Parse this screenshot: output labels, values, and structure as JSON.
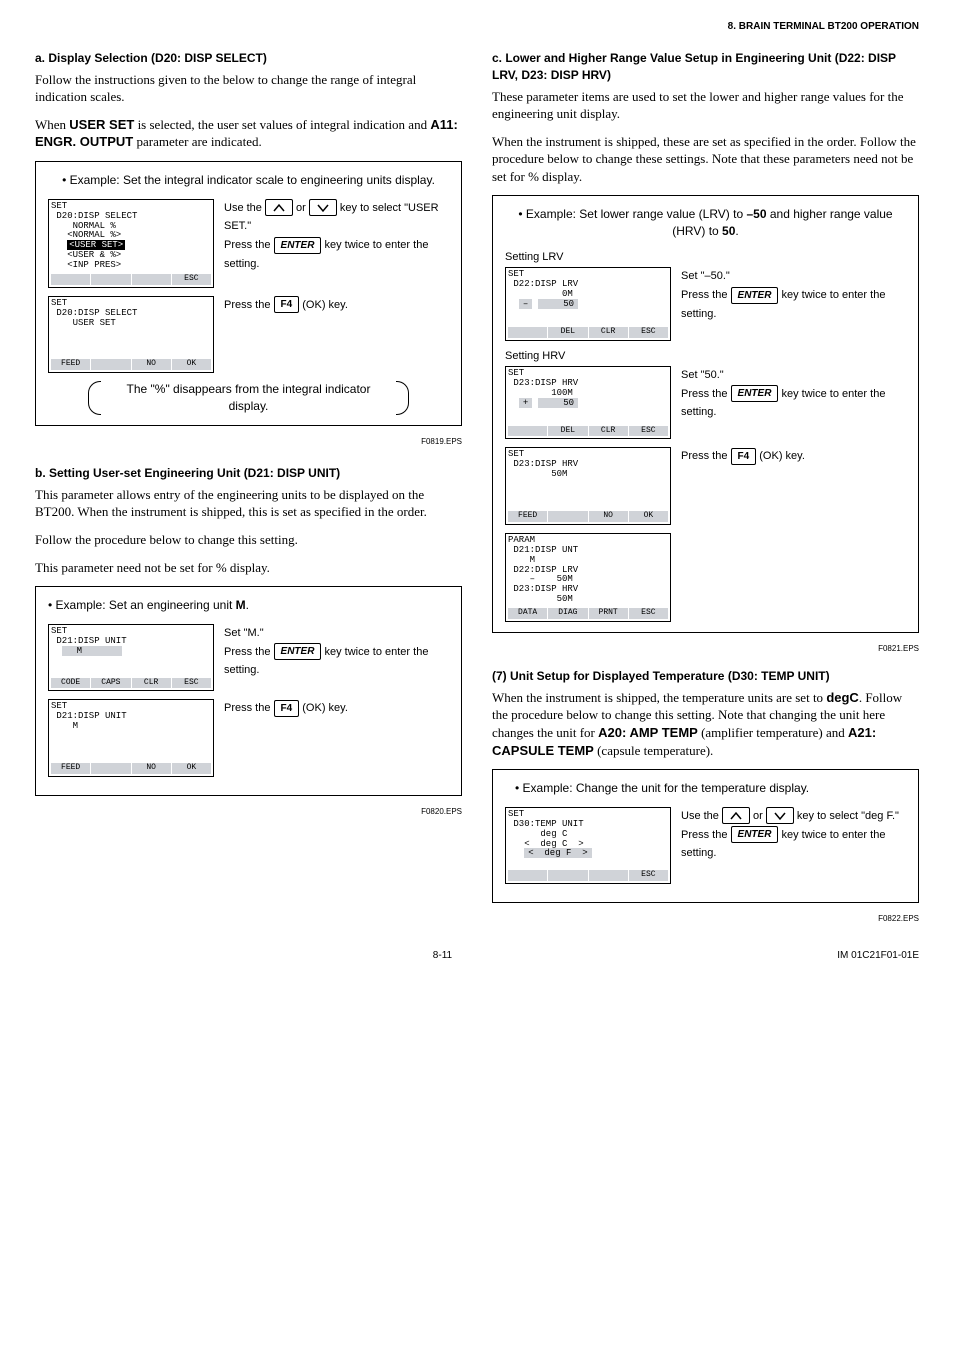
{
  "header": "8. BRAIN TERMINAL BT200 OPERATION",
  "left": {
    "a_title": "a. Display Selection (D20: DISP SELECT)",
    "a_p1": "Follow the instructions given to the below to change the range of integral indication scales.",
    "a_p2a": "When ",
    "a_p2b": "USER SET",
    "a_p2c": " is selected, the user set values of integral indication and ",
    "a_p2d": "A11: ENGR. OUTPUT",
    "a_p2e": " parameter are indicated.",
    "ex1_title": "• Example: Set the integral indicator scale to engineering units display.",
    "lcd1": {
      "l1": "SET",
      "l2": " D20:DISP SELECT",
      "l3": "    NORMAL %",
      "l4": "   <NORMAL %>",
      "l5hi": "<USER SET>",
      "l6": "   <USER & %>",
      "l7": "   <INP PRES>"
    },
    "d1a": "Use the ",
    "d1b": " or ",
    "d1c": " key to select \"USER SET.\"",
    "d1d": "Press the ",
    "d1e": " key twice to enter the setting.",
    "lcd2": {
      "l1": "SET",
      "l2": " D20:DISP SELECT",
      "l3": "    USER SET"
    },
    "d2a": "Press the ",
    "d2b": " (OK) key.",
    "bracket1": "The \"%\" disappears from the integral indicator display.",
    "fig1": "F0819.EPS",
    "sk": {
      "feed": "FEED",
      "no": "NO",
      "ok": "OK",
      "esc": "ESC",
      "code": "CODE",
      "caps": "CAPS",
      "clr": "CLR",
      "del": "DEL",
      "data": "DATA",
      "diag": "DIAG",
      "prnt": "PRNT"
    },
    "keys": {
      "enter": "ENTER",
      "f4": "F4"
    },
    "b_title": "b. Setting User-set Engineering Unit (D21: DISP UNIT)",
    "b_p1": "This parameter allows entry of the engineering units to be displayed on the BT200. When the instrument is shipped, this is set as specified in the order.",
    "b_p2": "Follow the procedure below to change this setting.",
    "b_p3": "This parameter need not be set for % display.",
    "ex2_title": "• Example: Set an engineering unit ",
    "ex2_title_b": "M",
    "lcd3": {
      "l1": "SET",
      "l2": " D21:DISP UNIT",
      "l3": "  M"
    },
    "d3a": "Set \"M.\"",
    "lcd4": {
      "l1": "SET",
      "l2": " D21:DISP UNIT",
      "l3": "    M"
    },
    "fig2": "F0820.EPS"
  },
  "right": {
    "c_title": "c. Lower and Higher Range Value Setup in Engineering Unit (D22: DISP LRV, D23: DISP HRV)",
    "c_p1": "These parameter items are used to set the lower and higher range values for the engineering unit display.",
    "c_p2": "When the instrument is shipped, these are set as specified in the order. Follow the procedure below to change these settings. Note that these parameters need not be set for % display.",
    "ex3_t1": "• Example: Set lower range value (LRV) to ",
    "ex3_t2": "–50",
    "ex3_t3": " and higher range value (HRV) to ",
    "ex3_t4": "50",
    "sub_lrv": "Setting LRV",
    "lcd5": {
      "l1": "SET",
      "l2": " D22:DISP LRV",
      "l3": "          0M",
      "l4a": "–",
      "l4b": "    50"
    },
    "d5a": "Set \"–50.\"",
    "sub_hrv": "Setting HRV",
    "lcd6": {
      "l1": "SET",
      "l2": " D23:DISP HRV",
      "l3": "        100M",
      "l4a": "+",
      "l4b": "    50"
    },
    "d6a": "Set \"50.\"",
    "lcd7": {
      "l1": "SET",
      "l2": " D23:DISP HRV",
      "l3": "        50M"
    },
    "lcd8": {
      "l1": "PARAM",
      "l2": " D21:DISP UNT",
      "l3": "    M",
      "l4": " D22:DISP LRV",
      "l5": "    –    50M",
      "l6": " D23:DISP HRV",
      "l7": "         50M"
    },
    "fig3": "F0821.EPS",
    "s7_title": "(7) Unit Setup for Displayed Temperature (D30: TEMP UNIT)",
    "s7_p1a": "When the instrument is shipped, the temperature units are set to ",
    "s7_p1b": "degC",
    "s7_p1c": ". Follow the procedure below to change this setting. Note that changing the unit here changes the unit for ",
    "s7_p1d": "A20: AMP TEMP",
    "s7_p1e": " (amplifier temperature) and ",
    "s7_p1f": "A21: CAPSULE TEMP",
    "s7_p1g": " (capsule temperature).",
    "ex4_title": "• Example: Change the unit for the temperature display.",
    "lcd9": {
      "l1": "SET",
      "l2": " D30:TEMP UNIT",
      "l3": "      deg C",
      "l4": "   <  deg C  >",
      "l5": "   <  deg F  >"
    },
    "d9a": "Use the ",
    "d9b": " or ",
    "d9c": " key to select \"deg F.\"",
    "fig4": "F0822.EPS"
  },
  "footer": {
    "left": "8-11",
    "right": "IM 01C21F01-01E"
  }
}
